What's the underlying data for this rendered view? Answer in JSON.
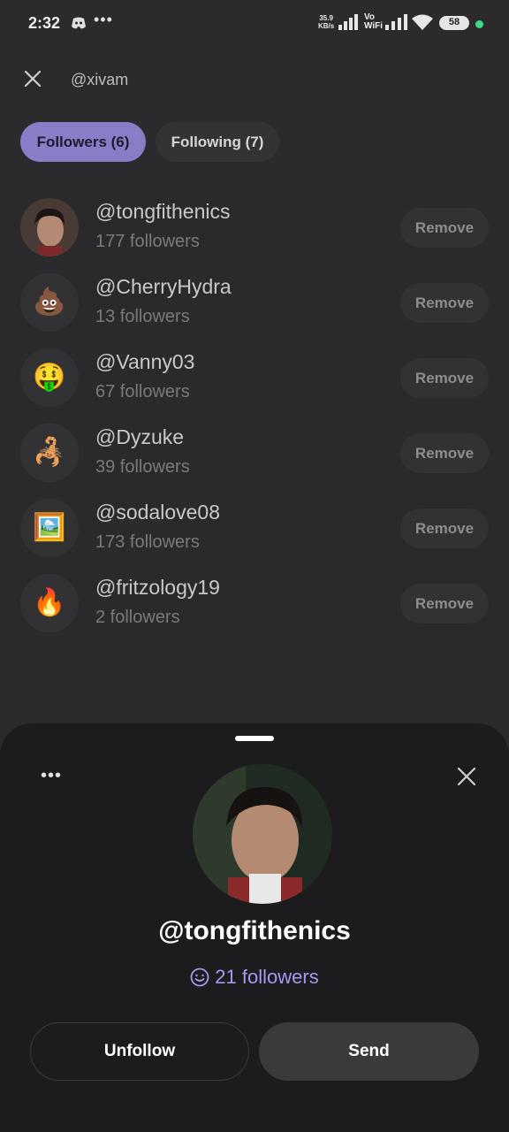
{
  "status_bar": {
    "time": "2:32",
    "speed_value": "35.9",
    "speed_unit": "KB/s",
    "vowifi_top": "Vo",
    "vowifi_bottom": "WiFi",
    "battery": "58"
  },
  "header": {
    "handle": "@xivam",
    "tabs": [
      {
        "label": "Followers (6)",
        "active": true
      },
      {
        "label": "Following (7)",
        "active": false
      }
    ]
  },
  "followers": [
    {
      "username": "@tongfithenics",
      "followers": "177 followers",
      "avatar": "photo",
      "remove_label": "Remove"
    },
    {
      "username": "@CherryHydra",
      "followers": "13 followers",
      "avatar": "💩",
      "remove_label": "Remove"
    },
    {
      "username": "@Vanny03",
      "followers": "67 followers",
      "avatar": "🤑",
      "remove_label": "Remove"
    },
    {
      "username": "@Dyzuke",
      "followers": "39 followers",
      "avatar": "🦂",
      "remove_label": "Remove"
    },
    {
      "username": "@sodalove08",
      "followers": "173 followers",
      "avatar": "🖼️",
      "remove_label": "Remove"
    },
    {
      "username": "@fritzology19",
      "followers": "2 followers",
      "avatar": "🔥",
      "remove_label": "Remove"
    }
  ],
  "sheet": {
    "username": "@tongfithenics",
    "followers": "21 followers",
    "unfollow_label": "Unfollow",
    "send_label": "Send"
  },
  "colors": {
    "accent": "#8b7cc7",
    "followers_text": "#a997f0",
    "background": "#2b2b2e",
    "sheet_bg": "#1c1c1e"
  }
}
